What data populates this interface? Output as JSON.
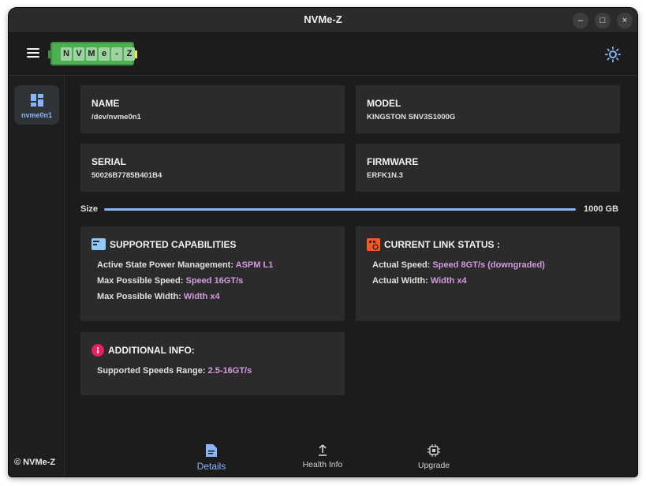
{
  "window": {
    "title": "NVMe-Z",
    "controls": [
      "–",
      "□",
      "×"
    ]
  },
  "logo": {
    "letters": [
      "N",
      "V",
      "M",
      "e",
      "-",
      "Z"
    ]
  },
  "sidebar": {
    "devices": [
      {
        "label": "nvme0n1",
        "icon": "dashboard-icon"
      }
    ],
    "copyright": "© NVMe-Z"
  },
  "info": {
    "name": {
      "label": "NAME",
      "value": "/dev/nvme0n1"
    },
    "model": {
      "label": "MODEL",
      "value": "KINGSTON SNV3S1000G"
    },
    "serial": {
      "label": "SERIAL",
      "value": "50026B7785B401B4"
    },
    "firmware": {
      "label": "FIRMWARE",
      "value": "ERFK1N.3"
    }
  },
  "size": {
    "label": "Size",
    "value": "1000 GB",
    "fill_fraction": 1.0
  },
  "capabilities": {
    "title": "SUPPORTED CAPABILITIES",
    "rows": [
      {
        "key": "Active State Power Management:",
        "value": "ASPM L1"
      },
      {
        "key": "Max Possible Speed:",
        "value": "Speed 16GT/s"
      },
      {
        "key": "Max Possible Width:",
        "value": "Width x4"
      }
    ]
  },
  "link_status": {
    "title": "CURRENT LINK STATUS :",
    "rows": [
      {
        "key": "Actual Speed:",
        "value": "Speed 8GT/s (downgraded)"
      },
      {
        "key": "Actual Width:",
        "value": "Width x4"
      }
    ]
  },
  "additional": {
    "title": "ADDITIONAL INFO:",
    "rows": [
      {
        "key": "Supported Speeds Range:",
        "value": "2.5-16GT/s"
      }
    ]
  },
  "nav": {
    "details": "Details",
    "health": "Health Info",
    "upgrade": "Upgrade"
  },
  "colors": {
    "accent": "#8ab4f8",
    "value": "#d29be0",
    "capabilities_icon": "#90caf9",
    "link_icon": "#ff5722",
    "info_icon": "#e91e63"
  }
}
